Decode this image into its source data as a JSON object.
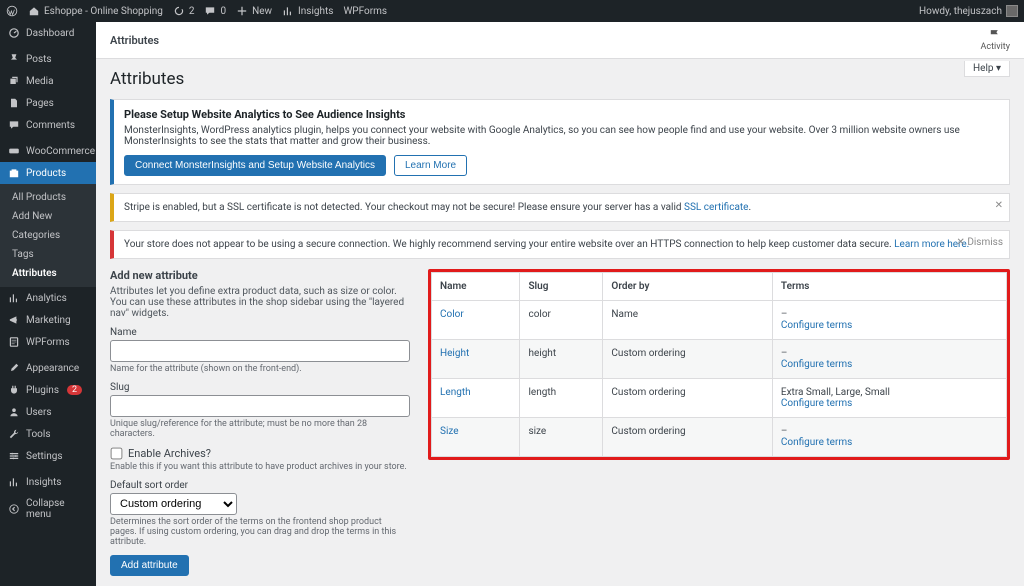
{
  "adminbar": {
    "site_name": "Eshoppe - Online Shopping",
    "updates": "2",
    "comments": "0",
    "new": "New",
    "insights": "Insights",
    "wpforms": "WPForms",
    "howdy": "Howdy, thejuszach"
  },
  "sidebar": {
    "items": [
      {
        "label": "Dashboard",
        "icon": "dashboard"
      },
      {
        "label": "Posts",
        "icon": "pin"
      },
      {
        "label": "Media",
        "icon": "media"
      },
      {
        "label": "Pages",
        "icon": "pages"
      },
      {
        "label": "Comments",
        "icon": "comment"
      },
      {
        "label": "WooCommerce",
        "icon": "woo"
      },
      {
        "label": "Products",
        "icon": "products",
        "current": true,
        "sub": [
          {
            "label": "All Products"
          },
          {
            "label": "Add New"
          },
          {
            "label": "Categories"
          },
          {
            "label": "Tags"
          },
          {
            "label": "Attributes",
            "current": true
          }
        ]
      },
      {
        "label": "Analytics",
        "icon": "analytics"
      },
      {
        "label": "Marketing",
        "icon": "marketing"
      },
      {
        "label": "WPForms",
        "icon": "wpforms"
      },
      {
        "label": "Appearance",
        "icon": "appearance"
      },
      {
        "label": "Plugins",
        "icon": "plugins",
        "badge": "2"
      },
      {
        "label": "Users",
        "icon": "users"
      },
      {
        "label": "Tools",
        "icon": "tools"
      },
      {
        "label": "Settings",
        "icon": "settings"
      },
      {
        "label": "Insights",
        "icon": "insights"
      },
      {
        "label": "Collapse menu",
        "icon": "collapse"
      }
    ]
  },
  "topstrip": {
    "title": "Attributes",
    "activity": "Activity"
  },
  "help_tab": "Help ▾",
  "page_title": "Attributes",
  "notices": {
    "mi": {
      "heading": "Please Setup Website Analytics to See Audience Insights",
      "body": "MonsterInsights, WordPress analytics plugin, helps you connect your website with Google Analytics, so you can see how people find and use your website. Over 3 million website owners use MonsterInsights to see the stats that matter and grow their business.",
      "btn_connect": "Connect MonsterInsights and Setup Website Analytics",
      "btn_learn": "Learn More"
    },
    "stripe": {
      "prefix": "Stripe is enabled, but a SSL certificate is not detected. Your checkout may not be secure! Please ensure your server has a valid ",
      "link": "SSL certificate",
      "suffix": "."
    },
    "ssl": {
      "prefix": "Your store does not appear to be using a secure connection. We highly recommend serving your entire website over an HTTPS connection to help keep customer data secure. ",
      "link": "Learn more here.",
      "dismiss": "Dismiss"
    }
  },
  "form": {
    "heading": "Add new attribute",
    "intro": "Attributes let you define extra product data, such as size or color. You can use these attributes in the shop sidebar using the \"layered nav\" widgets.",
    "name_label": "Name",
    "name_help": "Name for the attribute (shown on the front-end).",
    "slug_label": "Slug",
    "slug_help": "Unique slug/reference for the attribute; must be no more than 28 characters.",
    "archives_label": "Enable Archives?",
    "archives_help": "Enable this if you want this attribute to have product archives in your store.",
    "order_label": "Default sort order",
    "order_value": "Custom ordering",
    "order_help": "Determines the sort order of the terms on the frontend shop product pages. If using custom ordering, you can drag and drop the terms in this attribute.",
    "submit": "Add attribute"
  },
  "table": {
    "headers": {
      "name": "Name",
      "slug": "Slug",
      "order": "Order by",
      "terms": "Terms"
    },
    "configure": "Configure terms",
    "rows": [
      {
        "name": "Color",
        "slug": "color",
        "order": "Name",
        "terms": "–"
      },
      {
        "name": "Height",
        "slug": "height",
        "order": "Custom ordering",
        "terms": "–"
      },
      {
        "name": "Length",
        "slug": "length",
        "order": "Custom ordering",
        "terms": "Extra Small, Large, Small"
      },
      {
        "name": "Size",
        "slug": "size",
        "order": "Custom ordering",
        "terms": "–"
      }
    ]
  }
}
